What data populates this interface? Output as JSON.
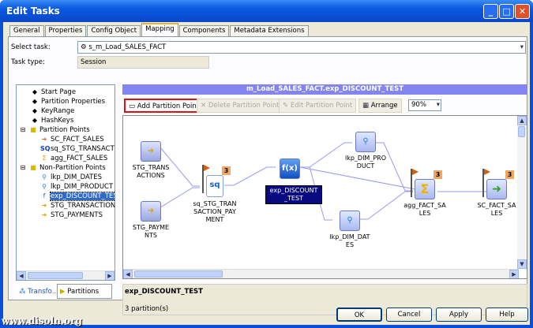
{
  "window": {
    "title": "Edit Tasks",
    "min": "_",
    "max": "□",
    "close": "✕"
  },
  "tabs": [
    "General",
    "Properties",
    "Config Object",
    "Mapping",
    "Components",
    "Metadata Extensions"
  ],
  "select_task": {
    "label": "Select task:",
    "value": "s_m_Load_SALES_FACT"
  },
  "task_type": {
    "label": "Task type:",
    "value": "Session"
  },
  "tree": {
    "items": [
      "Start Page",
      "Partition Properties",
      "KeyRange",
      "HashKeys"
    ],
    "partition_points": {
      "label": "Partition Points",
      "items": [
        "SC_FACT_SALES",
        "sq_STG_TRANSACTIONS",
        "agg_FACT_SALES"
      ]
    },
    "non_partition_points": {
      "label": "Non-Partition Points",
      "items": [
        "lkp_DIM_DATES",
        "lkp_DIM_PRODUCT",
        "exp_DISCOUNT_TEST",
        "STG_TRANSACTIONS",
        "STG_PAYMENTS"
      ]
    }
  },
  "bottom_tabs": [
    "Transfo...",
    "Partitions"
  ],
  "mapping_header": "m_Load_SALES_FACT.exp_DISCOUNT_TEST",
  "toolbar": {
    "add": "Add Partition Point",
    "delete": "Delete Partition Point",
    "edit": "Edit Partition Point",
    "arrange": "Arrange",
    "zoom": "90%"
  },
  "nodes": {
    "stg_trans": "STG_TRANSACTIONS",
    "stg_pay": "STG_PAYMENTS",
    "sq": "sq_STG_TRANSACTION_PAYMENT",
    "sq_parts": "3",
    "exp": "exp_DISCOUNT_TEST",
    "lkp_prod": "lkp_DIM_PRODUCT",
    "lkp_dates": "lkp_DIM_DATES",
    "agg": "agg_FACT_SALES",
    "agg_parts": "3",
    "sc": "SC_FACT_SALES",
    "sc_parts": "3"
  },
  "status": {
    "name": "exp_DISCOUNT_TEST",
    "partitions": "3 partition(s)"
  },
  "buttons": {
    "ok": "OK",
    "cancel": "Cancel",
    "apply": "Apply",
    "help": "Help"
  },
  "watermark": "www.disoln.org"
}
